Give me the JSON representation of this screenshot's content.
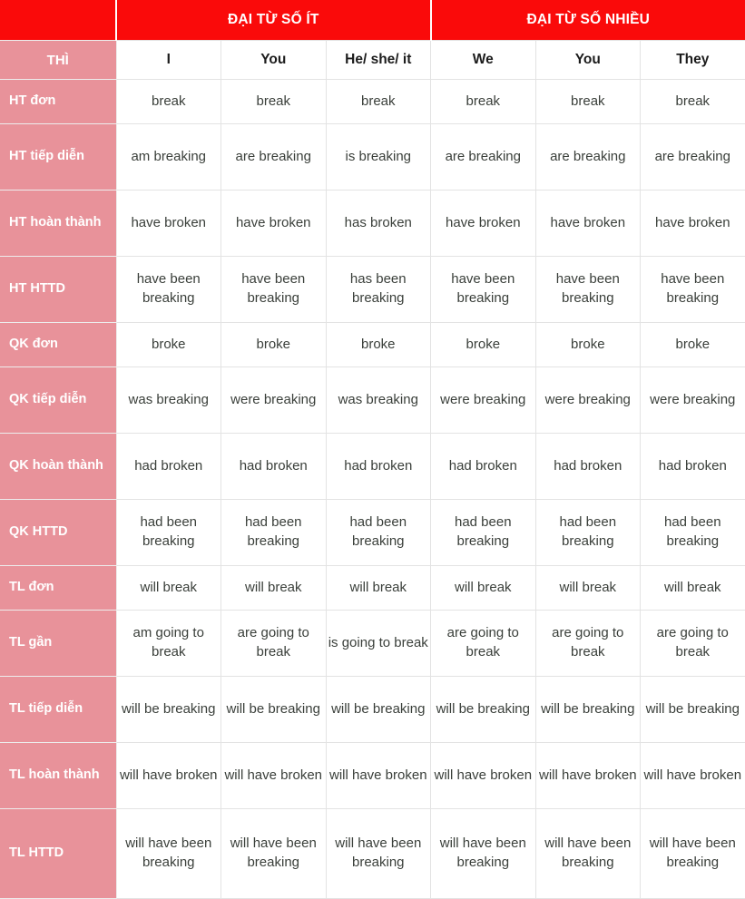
{
  "table": {
    "verb": "break",
    "colors": {
      "banner_red": "#fa0a0a",
      "label_pink": "#e8929a",
      "cell_text": "#3a3f3a",
      "grid_line": "#e3e3e3",
      "header_text": "#ffffff"
    },
    "group_headers": [
      {
        "label": "ĐẠI TỪ SỐ ÍT",
        "span": 3
      },
      {
        "label": "ĐẠI TỪ SỐ NHIỀU",
        "span": 3
      }
    ],
    "corner_label": "THÌ",
    "person_headers": [
      "I",
      "You",
      "He/ she/ it",
      "We",
      "You",
      "They"
    ],
    "rows": [
      {
        "label": "HT đơn",
        "cells": [
          "break",
          "break",
          "break",
          "break",
          "break",
          "break"
        ]
      },
      {
        "label": "HT tiếp diễn",
        "cells": [
          "am breaking",
          "are breaking",
          "is breaking",
          "are breaking",
          "are breaking",
          "are breaking"
        ]
      },
      {
        "label": "HT hoàn thành",
        "cells": [
          "have broken",
          "have broken",
          "has broken",
          "have broken",
          "have broken",
          "have broken"
        ]
      },
      {
        "label": "HT HTTD",
        "cells": [
          "have been breaking",
          "have been breaking",
          "has been breaking",
          "have been breaking",
          "have been breaking",
          "have been breaking"
        ]
      },
      {
        "label": "QK đơn",
        "cells": [
          "broke",
          "broke",
          "broke",
          "broke",
          "broke",
          "broke"
        ]
      },
      {
        "label": "QK tiếp diễn",
        "cells": [
          "was breaking",
          "were breaking",
          "was breaking",
          "were breaking",
          "were breaking",
          "were breaking"
        ]
      },
      {
        "label": "QK hoàn thành",
        "cells": [
          "had broken",
          "had broken",
          "had broken",
          "had broken",
          "had broken",
          "had broken"
        ]
      },
      {
        "label": "QK HTTD",
        "cells": [
          "had been breaking",
          "had been breaking",
          "had been breaking",
          "had been breaking",
          "had been breaking",
          "had been breaking"
        ]
      },
      {
        "label": "TL đơn",
        "cells": [
          "will break",
          "will break",
          "will break",
          "will break",
          "will break",
          "will break"
        ]
      },
      {
        "label": "TL gần",
        "cells": [
          "am going to break",
          "are going to break",
          "is going to break",
          "are going to break",
          "are going to break",
          "are going to break"
        ]
      },
      {
        "label": "TL tiếp diễn",
        "cells": [
          "will be breaking",
          "will be breaking",
          "will be breaking",
          "will be breaking",
          "will be breaking",
          "will be breaking"
        ]
      },
      {
        "label": "TL hoàn thành",
        "cells": [
          "will have broken",
          "will have broken",
          "will have broken",
          "will have broken",
          "will have broken",
          "will have broken"
        ]
      },
      {
        "label": "TL HTTD",
        "cells": [
          "will have been breaking",
          "will have been breaking",
          "will have been breaking",
          "will have been breaking",
          "will have been breaking",
          "will have been breaking"
        ]
      }
    ]
  }
}
